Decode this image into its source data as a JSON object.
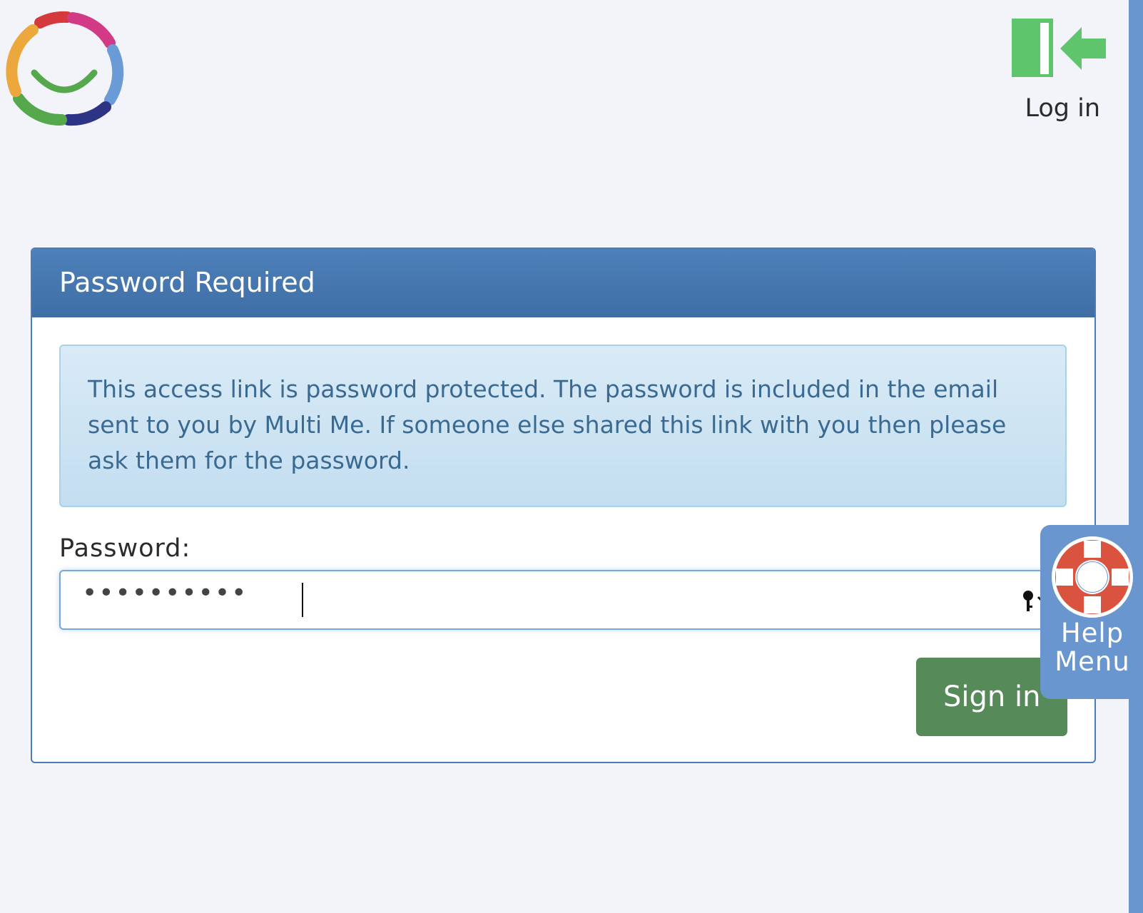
{
  "header": {
    "login_label": "Log in"
  },
  "panel": {
    "title": "Password Required",
    "alert_text": "This access link is password protected. The password is included in the email sent to you by Multi Me. If someone else shared this link with you then please ask them for the password.",
    "password_label": "Password:",
    "password_value": "••••••••••",
    "signin_label": "Sign in"
  },
  "help": {
    "label": "Help Menu"
  },
  "icons": {
    "logo": "multi-me-ring-logo",
    "login": "door-arrow-icon",
    "key": "key-icon",
    "help": "lifebuoy-icon"
  },
  "colors": {
    "panel_header": "#4a7cb8",
    "signin_button": "#568a58",
    "help_tab": "#6a96cf",
    "login_icon": "#5ec56c",
    "lifebuoy": "#d9533f"
  }
}
